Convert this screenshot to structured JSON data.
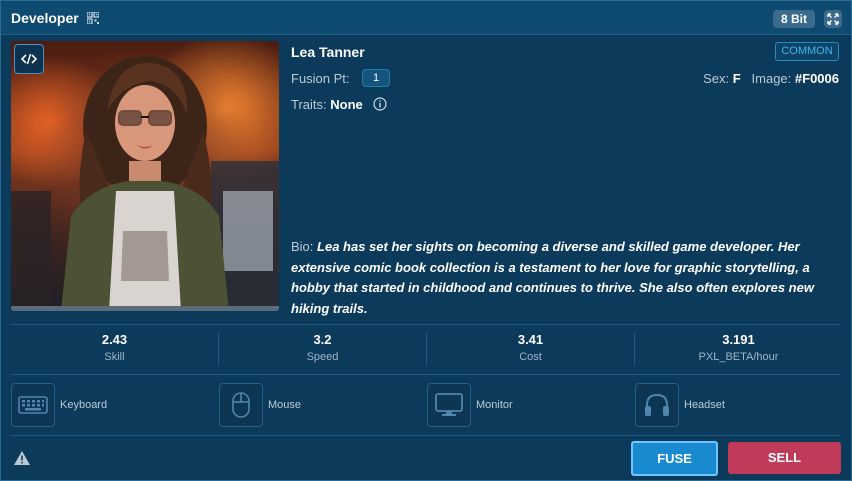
{
  "header": {
    "title": "Developer",
    "tier": "8 Bit"
  },
  "character": {
    "name": "Lea Tanner",
    "rarity": "COMMON",
    "fusion_label": "Fusion Pt:",
    "fusion_points": "1",
    "sex_label": "Sex:",
    "sex": "F",
    "image_label": "Image:",
    "image_id": "#F0006",
    "traits_label": "Traits:",
    "traits": "None",
    "bio_label": "Bio:",
    "bio": "Lea has set her sights on becoming a diverse and skilled game developer. Her extensive comic book collection is a testament to her love for graphic storytelling, a hobby that started in childhood and continues to thrive. She also often explores new hiking trails."
  },
  "stats": [
    {
      "value": "2.43",
      "label": "Skill"
    },
    {
      "value": "3.2",
      "label": "Speed"
    },
    {
      "value": "3.41",
      "label": "Cost"
    },
    {
      "value": "3.191",
      "label": "PXL_BETA/hour"
    }
  ],
  "equipment": [
    {
      "label": "Keyboard",
      "icon": "keyboard-icon"
    },
    {
      "label": "Mouse",
      "icon": "mouse-icon"
    },
    {
      "label": "Monitor",
      "icon": "monitor-icon"
    },
    {
      "label": "Headset",
      "icon": "headset-icon"
    }
  ],
  "actions": {
    "fuse": "FUSE",
    "sell": "SELL"
  },
  "colors": {
    "accent": "#1a8ad0",
    "sell": "#c03a5a",
    "rarity": "#3fb4ef"
  }
}
